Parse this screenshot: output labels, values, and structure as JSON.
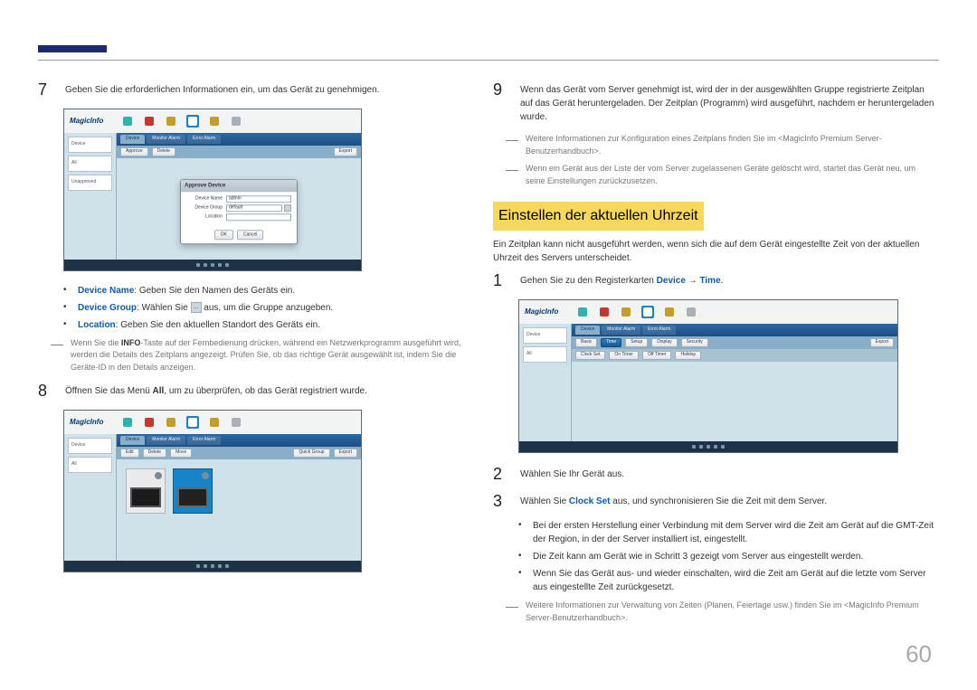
{
  "page_number": "60",
  "left": {
    "step7_text": "Geben Sie die erforderlichen Informationen ein, um das Gerät zu genehmigen.",
    "bullets": {
      "b1_label": "Device Name",
      "b1_text": ": Geben Sie den Namen des Geräts ein.",
      "b2_label": "Device Group",
      "b2_text_pre": ": Wählen Sie ",
      "b2_text_post": " aus, um die Gruppe anzugeben.",
      "b3_label": "Location",
      "b3_text": ": Geben Sie den aktuellen Standort des Geräts ein."
    },
    "info_note_pre": "Wenn Sie die ",
    "info_note_bold": "INFO",
    "info_note_post": "-Taste auf der Fernbedienung drücken, während ein Netzwerkprogramm ausgeführt wird, werden die Details des Zeitplans angezeigt. Prüfen Sie, ob das richtige Gerät ausgewählt ist, indem Sie die Geräte-ID in den Details anzeigen.",
    "step8_pre": "Öffnen Sie das Menü ",
    "step8_bold": "All",
    "step8_post": ", um zu überprüfen, ob das Gerät registriert wurde."
  },
  "right": {
    "step9_text": "Wenn das Gerät vom Server genehmigt ist, wird der in der ausgewählten Gruppe registrierte Zeitplan auf das Gerät heruntergeladen. Der Zeitplan (Programm) wird ausgeführt, nachdem er heruntergeladen wurde.",
    "note1": "Weitere Informationen zur Konfiguration eines Zeitplans finden Sie im <MagicInfo Premium Server-Benutzerhandbuch>.",
    "note2": "Wenn ein Gerät aus der Liste der vom Server zugelassenen Geräte gelöscht wird, startet das Gerät neu, um seine Einstellungen zurückzusetzen.",
    "heading": "Einstellen der aktuellen Uhrzeit",
    "intro": "Ein Zeitplan kann nicht ausgeführt werden, wenn sich die auf dem Gerät eingestellte Zeit von der aktuellen Uhrzeit des Servers unterscheidet.",
    "step1_pre": "Gehen Sie zu den Registerkarten ",
    "step1_device": "Device",
    "step1_arrow": " → ",
    "step1_time": "Time",
    "step1_post": ".",
    "step2_text": "Wählen Sie Ihr Gerät aus.",
    "step3_pre": "Wählen Sie ",
    "step3_clock": "Clock Set",
    "step3_post": " aus, und synchronisieren Sie die Zeit mit dem Server.",
    "sb1": "Bei der ersten Herstellung einer Verbindung mit dem Server wird die Zeit am Gerät auf die GMT-Zeit der Region, in der der Server installiert ist, eingestellt.",
    "sb2": "Die Zeit kann am Gerät wie in Schritt 3 gezeigt vom Server aus eingestellt werden.",
    "sb3": "Wenn Sie das Gerät aus- und wieder einschalten, wird die Zeit am Gerät auf die letzte vom Server aus eingestellte Zeit zurückgesetzt.",
    "note3": "Weitere Informationen zur Verwaltung von Zeiten (Planen, Feiertage usw.) finden Sie im <MagicInfo Premium Server-Benutzerhandbuch>."
  },
  "screenshots": {
    "logo": "MagicInfo",
    "tabs": [
      "Device",
      "Monitor Alarm",
      "Error Alarm"
    ],
    "dialog": {
      "title": "Approve Device",
      "rows": [
        {
          "label": "Device Name",
          "value": "admin"
        },
        {
          "label": "Device Group",
          "value": "default"
        },
        {
          "label": "Location"
        }
      ],
      "ok": "OK",
      "cancel": "Cancel"
    },
    "time_tabs": [
      "Basic",
      "Time",
      "Setup",
      "Display",
      "Security"
    ]
  }
}
